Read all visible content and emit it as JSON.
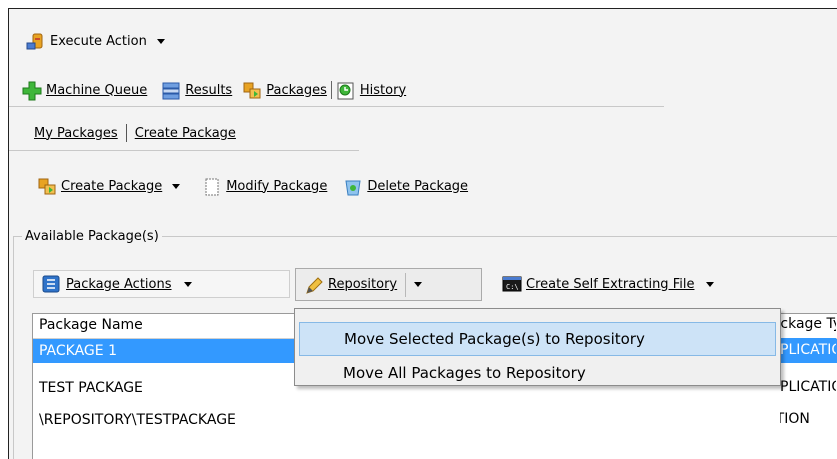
{
  "toolbar1": {
    "execute_action": "Execute Action"
  },
  "nav_tabs": {
    "machine_queue": "Machine Queue",
    "results": "Results",
    "packages": "Packages",
    "history": "History"
  },
  "sub_tabs": {
    "my_packages": "My Packages",
    "create_package": "Create Package"
  },
  "toolbar2": {
    "create_package": "Create Package",
    "modify_package": "Modify Package",
    "delete_package": "Delete Package"
  },
  "group": {
    "label": "Available Package(s)"
  },
  "toolbar3": {
    "package_actions": "Package Actions",
    "repository": "Repository",
    "create_self_extracting": "Create Self Extracting File"
  },
  "grid": {
    "headers": [
      "Package Name",
      "Package Type"
    ],
    "rows": [
      {
        "name": "PACKAGE 1",
        "type": "APPLICATION"
      },
      {
        "name": "TEST PACKAGE",
        "type": "APPLICATION"
      },
      {
        "name": "\\REPOSITORY\\TESTPACKAGE",
        "type": "APPLICATION"
      }
    ]
  },
  "menu": {
    "items": [
      "Move Selected Package(s) to Repository",
      "Move All Packages to Repository"
    ]
  },
  "colors": {
    "selection": "#3399ff",
    "menu_highlight": "#cde3f7"
  }
}
